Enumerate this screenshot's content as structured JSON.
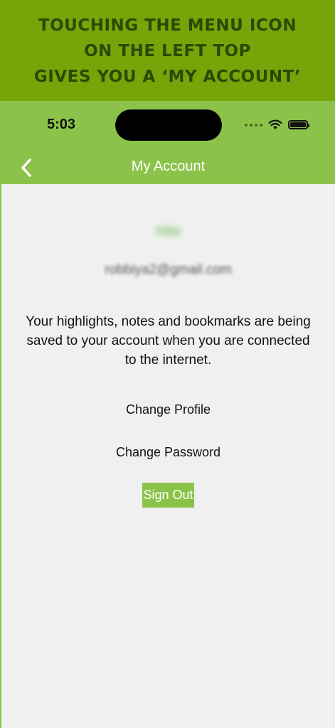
{
  "banner": {
    "lines": [
      "TOUCHING THE MENU ICON",
      "ON THE LEFT TOP",
      "GIVES YOU A ‘MY ACCOUNT’"
    ]
  },
  "status_bar": {
    "time": "5:03"
  },
  "navbar": {
    "title": "My Account",
    "back_icon": "chevron-left-icon"
  },
  "account": {
    "username": "rou",
    "email": "robbiya2@gmail.com",
    "message": "Your highlights, notes and bookmarks are being saved to your account when you are connected to the internet."
  },
  "actions": {
    "change_profile": "Change Profile",
    "change_password": "Change Password",
    "sign_out": "Sign Out"
  },
  "colors": {
    "banner_bg": "#77a409",
    "banner_text": "#2a4a05",
    "accent": "#8bc34a",
    "background": "#f0f0f0"
  }
}
